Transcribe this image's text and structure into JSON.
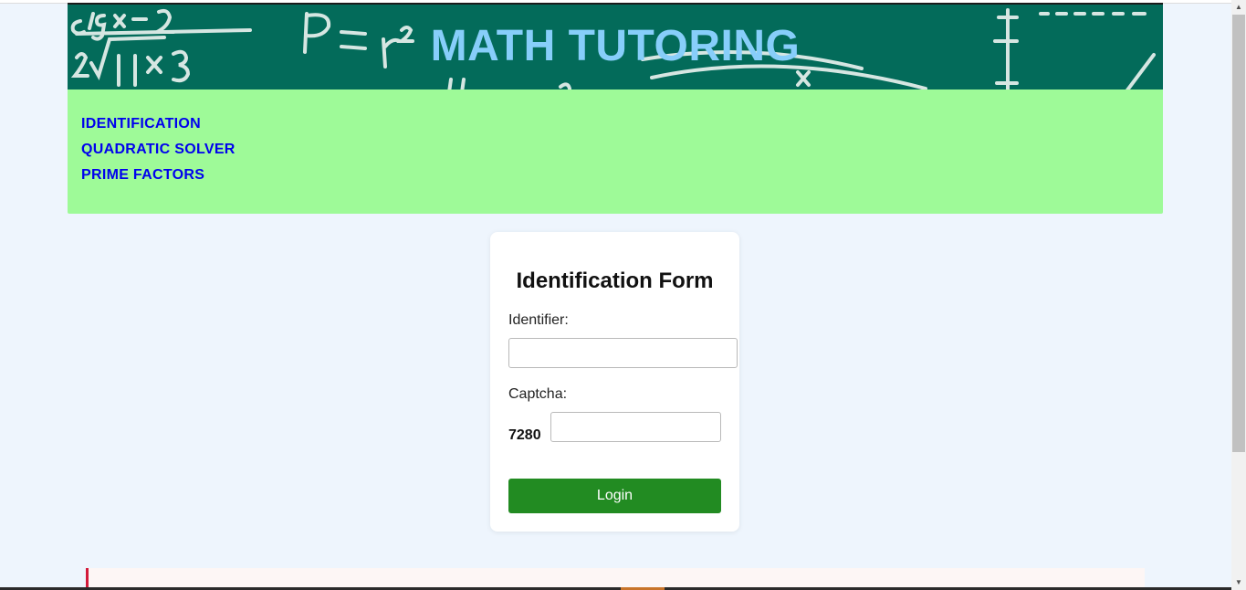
{
  "header": {
    "title": "MATH TUTORING"
  },
  "nav": {
    "items": [
      {
        "label": "IDENTIFICATION"
      },
      {
        "label": "QUADRATIC SOLVER"
      },
      {
        "label": "PRIME FACTORS"
      }
    ]
  },
  "form": {
    "title": "Identification Form",
    "identifier_label": "Identifier:",
    "identifier_value": "",
    "captcha_label": "Captcha:",
    "captcha_code": "7280",
    "captcha_value": "",
    "login_label": "Login"
  },
  "colors": {
    "banner_bg": "#036b5a",
    "banner_title": "#87cefa",
    "nav_bg": "#9efa98",
    "nav_link": "#0000ee",
    "login_button": "#228b22",
    "page_bg": "#eef5fd"
  },
  "icons": {
    "scroll_up": "scroll-up-arrow-icon",
    "scroll_down": "scroll-down-arrow-icon"
  }
}
